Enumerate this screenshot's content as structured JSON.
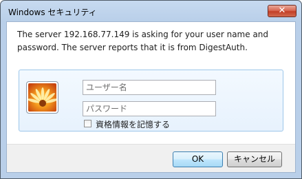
{
  "window": {
    "title": "Windows セキュリティ",
    "close_label": "✕"
  },
  "message": {
    "text": "The server 192.168.77.149 is asking for your user name and password. The server reports that it is from DigestAuth."
  },
  "credentials": {
    "username_placeholder": "ユーザー名",
    "password_placeholder": "パスワード",
    "remember_label": "資格情報を記憶する",
    "remember_checked": false
  },
  "buttons": {
    "ok": "OK",
    "cancel": "キャンセル"
  },
  "icons": {
    "avatar": "user-flower-avatar-icon",
    "close": "close-icon"
  }
}
